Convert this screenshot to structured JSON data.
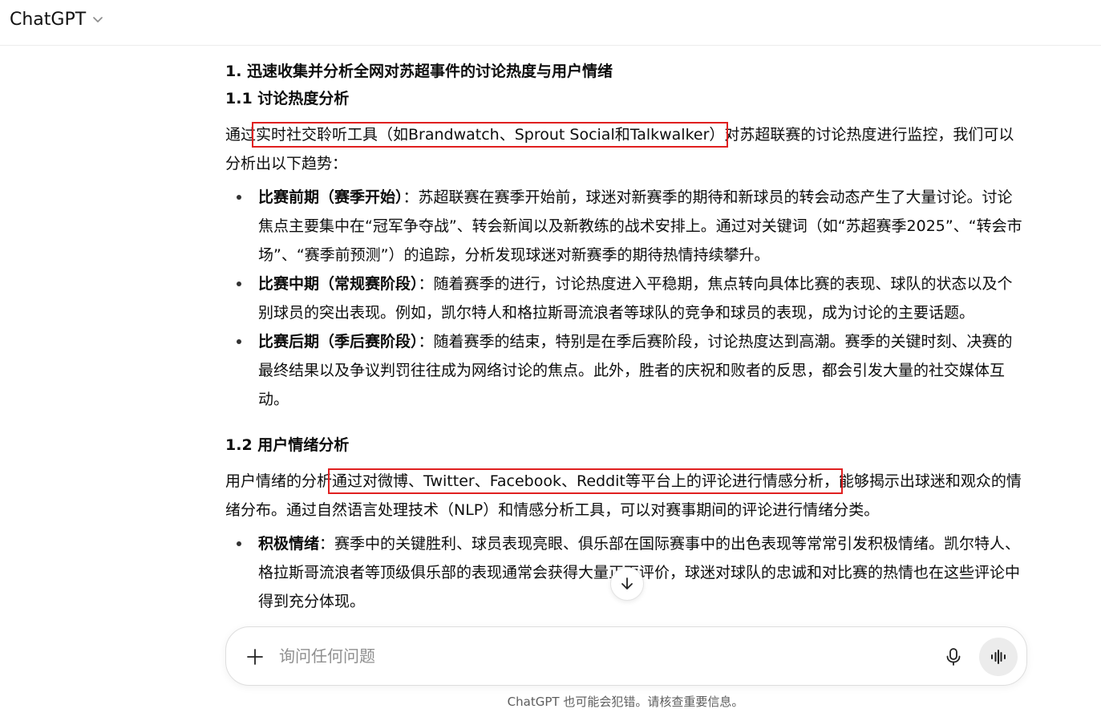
{
  "header": {
    "model_name": "ChatGPT"
  },
  "article": {
    "heading_1": "1. 迅速收集并分析全网对苏超事件的讨论热度与用户情绪",
    "heading_1_1": "1.1 讨论热度分析",
    "para_1": {
      "before": "通过",
      "highlight": "实时社交聆听工具（如Brandwatch、Sprout Social和Talkwalker）",
      "after": "对苏超联赛的讨论热度进行监控，我们可以分析出以下趋势："
    },
    "bullets_1": [
      {
        "term": "比赛前期（赛季开始）",
        "text": "：苏超联赛在赛季开始前，球迷对新赛季的期待和新球员的转会动态产生了大量讨论。讨论焦点主要集中在“冠军争夺战”、转会新闻以及新教练的战术安排上。通过对关键词（如“苏超赛季2025”、“转会市场”、“赛季前预测”）的追踪，分析发现球迷对新赛季的期待热情持续攀升。"
      },
      {
        "term": "比赛中期（常规赛阶段）",
        "text": "：随着赛季的进行，讨论热度进入平稳期，焦点转向具体比赛的表现、球队的状态以及个别球员的突出表现。例如，凯尔特人和格拉斯哥流浪者等球队的竞争和球员的表现，成为讨论的主要话题。"
      },
      {
        "term": "比赛后期（季后赛阶段）",
        "text": "：随着赛季的结束，特别是在季后赛阶段，讨论热度达到高潮。赛季的关键时刻、决赛的最终结果以及争议判罚往往成为网络讨论的焦点。此外，胜者的庆祝和败者的反思，都会引发大量的社交媒体互动。"
      }
    ],
    "heading_1_2": "1.2 用户情绪分析",
    "para_2": {
      "before": "用户情绪的分析",
      "highlight": "通过对微博、Twitter、Facebook、Reddit等平台上的评论进行情感分析，",
      "after": "能够揭示出球迷和观众的情绪分布。通过自然语言处理技术（NLP）和情感分析工具，可以对赛事期间的评论进行情绪分类。"
    },
    "bullets_2": [
      {
        "term": "积极情绪",
        "text": "：赛季中的关键胜利、球员表现亮眼、俱乐部在国际赛事中的出色表现等常常引发积极情绪。凯尔特人、格拉斯哥流浪者等顶级俱乐部的表现通常会获得大量正面评价，球迷对球队的忠诚和对比赛的热情也在这些评论中得到充分体现。"
      }
    ]
  },
  "composer": {
    "placeholder": "询问任何问题"
  },
  "footer": {
    "disclaimer": "ChatGPT 也可能会犯错。请核查重要信息。"
  }
}
